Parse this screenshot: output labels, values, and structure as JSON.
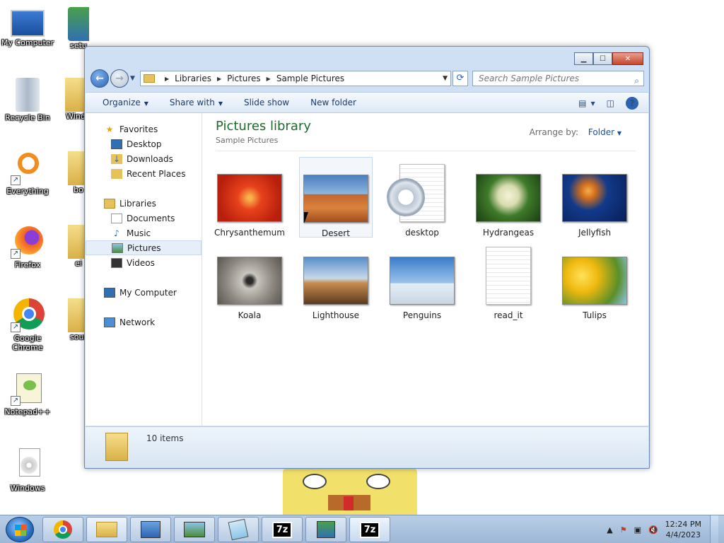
{
  "desktop": {
    "icons": [
      {
        "label": "My Computer"
      },
      {
        "label": "Recycle Bin"
      },
      {
        "label": "Everything"
      },
      {
        "label": "Firefox"
      },
      {
        "label": "Google Chrome"
      },
      {
        "label": "Notepad++"
      },
      {
        "label": "Windows"
      }
    ],
    "partial_icons": [
      {
        "label": "setu"
      },
      {
        "label": "Wind"
      },
      {
        "label": "bo"
      },
      {
        "label": "ei"
      },
      {
        "label": "sour"
      }
    ]
  },
  "window": {
    "address": {
      "crumbs": [
        "Libraries",
        "Pictures",
        "Sample Pictures"
      ]
    },
    "search": {
      "placeholder": "Search Sample Pictures"
    },
    "toolbar": {
      "organize": "Organize",
      "share_with": "Share with",
      "slide_show": "Slide show",
      "new_folder": "New folder"
    },
    "navpane": {
      "favorites": "Favorites",
      "desktop": "Desktop",
      "downloads": "Downloads",
      "recent_places": "Recent Places",
      "libraries": "Libraries",
      "documents": "Documents",
      "music": "Music",
      "pictures": "Pictures",
      "videos": "Videos",
      "my_computer": "My Computer",
      "network": "Network"
    },
    "content": {
      "title": "Pictures library",
      "subtitle": "Sample Pictures",
      "arrange_label": "Arrange by:",
      "arrange_value": "Folder",
      "items": [
        {
          "name": "Chrysanthemum"
        },
        {
          "name": "Desert"
        },
        {
          "name": "desktop"
        },
        {
          "name": "Hydrangeas"
        },
        {
          "name": "Jellyfish"
        },
        {
          "name": "Koala"
        },
        {
          "name": "Lighthouse"
        },
        {
          "name": "Penguins"
        },
        {
          "name": "read_it"
        },
        {
          "name": "Tulips"
        }
      ]
    },
    "status": {
      "count": "10 items"
    }
  },
  "taskbar": {
    "buttons": [
      "7z",
      "7z"
    ],
    "clock": {
      "time": "12:24 PM",
      "date": "4/4/2023"
    }
  }
}
